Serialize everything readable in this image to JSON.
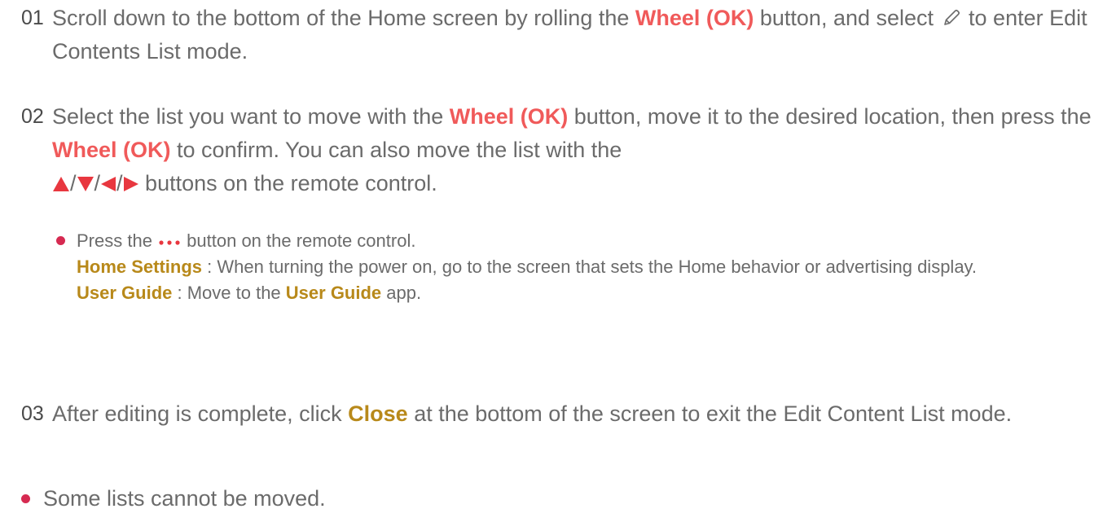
{
  "steps": [
    {
      "num": "01",
      "text_a": "Scroll down to the bottom of the Home screen by rolling the ",
      "wheel": "Wheel (OK)",
      "text_b": " button, and select ",
      "text_c": " to enter Edit Contents List mode."
    },
    {
      "num": "02",
      "text_a": "Select the list you want to move with the ",
      "wheel_1": "Wheel (OK)",
      "text_b": " button, move it to the desired location, then press the ",
      "wheel_2": "Wheel (OK)",
      "text_c": " to confirm. You can also move the list with the ",
      "slash": "/",
      "text_d": " buttons on the remote control."
    },
    {
      "num": "03",
      "text_a": "After editing is complete, click ",
      "close": "Close",
      "text_b": " at the bottom of the screen to exit the Edit Content List mode."
    }
  ],
  "sub_bullet": {
    "press_a": "Press the ",
    "press_b": " button on the remote control.",
    "home_settings": "Home Settings",
    "home_settings_desc": " : When turning the power on, go to the screen that sets the Home behavior or advertising display.",
    "user_guide": "User Guide",
    "user_guide_desc_a": " : Move to the ",
    "user_guide_link": "User Guide",
    "user_guide_desc_b": " app."
  },
  "note": "Some lists cannot be moved.",
  "colors": {
    "highlight_red": "#f05a5a",
    "highlight_gold": "#b8891a",
    "bullet": "#d62a51",
    "body_text": "#6b6b6b"
  },
  "icons": {
    "edit": "pencil-icon",
    "more": "dots-icon",
    "directions": [
      "arrow-up-icon",
      "arrow-down-icon",
      "arrow-left-icon",
      "arrow-right-icon"
    ]
  }
}
